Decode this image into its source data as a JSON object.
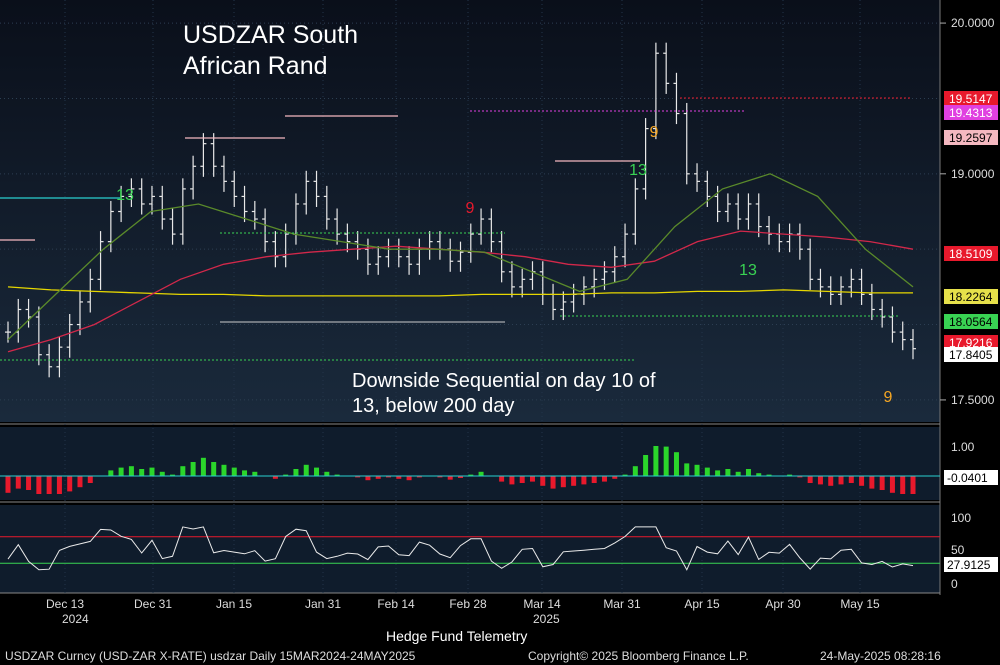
{
  "chart_data": {
    "type": "line",
    "title": "USDZAR South African Rand",
    "annotation": "Downside Sequential on day 10 of 13, below 200 day",
    "ticker_line": "USDZAR Curncy (USD-ZAR X-RATE) usdzar  Daily 15MAR2024-24MAY2025",
    "copyright": "Copyright© 2025 Bloomberg Finance L.P.",
    "timestamp": "24-May-2025 08:28:16",
    "source": "Hedge Fund Telemetry",
    "x_labels": [
      "Dec 13",
      "Dec 31",
      "Jan 15",
      "Jan 31",
      "Feb 14",
      "Feb 28",
      "Mar 14",
      "Mar 31",
      "Apr 15",
      "Apr 30",
      "May 15"
    ],
    "year_labels": [
      "2024",
      "2025"
    ],
    "price_axis": {
      "ticks": [
        "20.0000",
        "19.0000",
        "17.5000"
      ],
      "ylim": [
        17.4,
        20.1
      ]
    },
    "price_tags": [
      {
        "label": "19.5147",
        "color": "#e8192c"
      },
      {
        "label": "19.4313",
        "color": "#e040e0"
      },
      {
        "label": "19.2597",
        "color": "#f4b8c0"
      },
      {
        "label": "18.5109",
        "color": "#e8192c"
      },
      {
        "label": "18.2264",
        "color": "#e6e04a"
      },
      {
        "label": "18.0564",
        "color": "#39d353"
      },
      {
        "label": "17.9216",
        "color": "#e8192c"
      },
      {
        "label": "17.8405",
        "color": "#ffffff"
      }
    ],
    "close_series": [
      17.95,
      18.1,
      18.05,
      17.8,
      17.72,
      17.85,
      18.0,
      18.15,
      18.3,
      18.55,
      18.75,
      18.85,
      18.9,
      18.8,
      18.85,
      18.7,
      18.6,
      18.9,
      19.05,
      19.2,
      19.05,
      18.95,
      18.85,
      18.75,
      18.7,
      18.55,
      18.45,
      18.6,
      18.8,
      18.95,
      18.85,
      18.7,
      18.6,
      18.55,
      18.5,
      18.4,
      18.45,
      18.5,
      18.45,
      18.4,
      18.5,
      18.55,
      18.5,
      18.42,
      18.48,
      18.6,
      18.7,
      18.55,
      18.35,
      18.25,
      18.3,
      18.35,
      18.2,
      18.1,
      18.15,
      18.2,
      18.25,
      18.3,
      18.35,
      18.45,
      18.6,
      18.9,
      19.3,
      19.8,
      19.6,
      19.4,
      19.0,
      18.95,
      18.85,
      18.75,
      18.8,
      18.7,
      18.8,
      18.65,
      18.6,
      18.55,
      18.6,
      18.5,
      18.3,
      18.25,
      18.2,
      18.25,
      18.3,
      18.2,
      18.1,
      18.05,
      17.95,
      17.9,
      17.84
    ],
    "ma_series": [
      {
        "name": "200 day",
        "color": "#e6d700",
        "values": [
          18.25,
          18.23,
          18.22,
          18.21,
          18.2,
          18.2,
          18.19,
          18.19,
          18.19,
          18.19,
          18.19,
          18.2,
          18.2,
          18.2,
          18.21,
          18.21,
          18.22,
          18.22,
          18.23,
          18.22,
          18.21,
          18.21
        ]
      },
      {
        "name": "50 day",
        "color": "#d2284a",
        "values": [
          17.82,
          17.9,
          18.0,
          18.15,
          18.3,
          18.4,
          18.45,
          18.48,
          18.5,
          18.52,
          18.5,
          18.48,
          18.45,
          18.4,
          18.38,
          18.42,
          18.55,
          18.62,
          18.6,
          18.58,
          18.55,
          18.5
        ]
      },
      {
        "name": "20 day",
        "color": "#5a8a2a",
        "values": [
          17.9,
          18.2,
          18.5,
          18.75,
          18.8,
          18.7,
          18.6,
          18.55,
          18.5,
          18.5,
          18.48,
          18.35,
          18.22,
          18.3,
          18.65,
          18.9,
          19.0,
          18.85,
          18.5,
          18.25
        ]
      }
    ],
    "sequential_labels": [
      "13",
      "9",
      "13",
      "9",
      "13",
      "9",
      "13"
    ],
    "osc1": {
      "ticks": [
        "1.00",
        "-0.0401"
      ]
    },
    "osc2": {
      "ticks": [
        "100",
        "50",
        "27.9125",
        "0"
      ]
    }
  }
}
